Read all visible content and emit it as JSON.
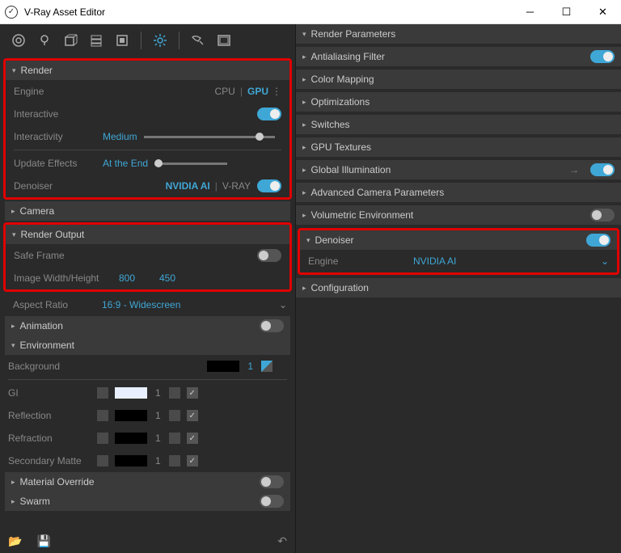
{
  "window": {
    "title": "V-Ray Asset Editor"
  },
  "left": {
    "render_section": "Render",
    "engine_label": "Engine",
    "engine_cpu": "CPU",
    "engine_gpu": "GPU",
    "interactive_label": "Interactive",
    "interactivity_label": "Interactivity",
    "interactivity_value": "Medium",
    "update_effects_label": "Update Effects",
    "update_effects_value": "At the End",
    "denoiser_label": "Denoiser",
    "denoiser_val1": "NVIDIA AI",
    "denoiser_val2": "V-RAY",
    "camera": "Camera",
    "render_output": "Render Output",
    "safe_frame": "Safe Frame",
    "img_wh_label": "Image Width/Height",
    "img_w": "800",
    "img_h": "450",
    "aspect_label": "Aspect Ratio",
    "aspect_value": "16:9 - Widescreen",
    "animation": "Animation",
    "environment": "Environment",
    "background": "Background",
    "background_num": "1",
    "gi": "GI",
    "gi_num": "1",
    "reflection": "Reflection",
    "reflection_num": "1",
    "refraction": "Refraction",
    "refraction_num": "1",
    "secondary_matte": "Secondary Matte",
    "secondary_matte_num": "1",
    "material_override": "Material Override",
    "swarm": "Swarm"
  },
  "right": {
    "render_params": "Render Parameters",
    "aa_filter": "Antialiasing Filter",
    "color_mapping": "Color Mapping",
    "optimizations": "Optimizations",
    "switches": "Switches",
    "gpu_textures": "GPU Textures",
    "global_illum": "Global Illumination",
    "adv_camera": "Advanced Camera Parameters",
    "volumetric": "Volumetric Environment",
    "denoiser": "Denoiser",
    "denoiser_engine_label": "Engine",
    "denoiser_engine_value": "NVIDIA AI",
    "configuration": "Configuration"
  }
}
